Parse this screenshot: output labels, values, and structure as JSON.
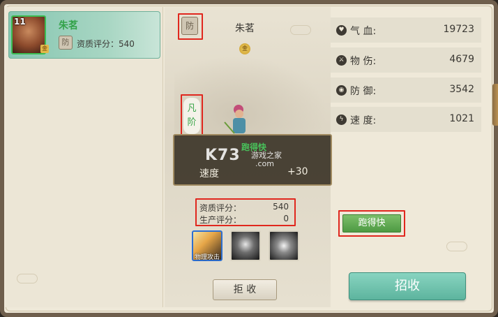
{
  "hero_card": {
    "level": "11",
    "name": "朱茗",
    "class_glyph": "防",
    "grade_glyph": "金",
    "score_text": "资质评分：540"
  },
  "unit": {
    "class_glyph": "防",
    "name": "朱茗",
    "grade_glyph": "金",
    "rank_text": "凡阶"
  },
  "tooltip": {
    "title": "跑得快",
    "stat_name": "速度",
    "stat_value": "+30"
  },
  "watermark": {
    "logo": "K73",
    "tagline": "游戏之家",
    "domain": ".com"
  },
  "scores": [
    {
      "label": "资质评分：",
      "value": "540"
    },
    {
      "label": "生产评分：",
      "value": "0"
    }
  ],
  "skills": {
    "skill_1_label": "物理攻击",
    "icons": [
      "physical-attack-skill-icon",
      "shadow-warrior-skill-icon",
      "spiral-skill-icon"
    ]
  },
  "stats": [
    {
      "icon": "heart-icon",
      "name": "气 血:",
      "value": "19723"
    },
    {
      "icon": "sword-icon",
      "name": "物 伤:",
      "value": "4679"
    },
    {
      "icon": "shield-icon",
      "name": "防 御:",
      "value": "3542"
    },
    {
      "icon": "lightning-icon",
      "name": "速 度:",
      "value": "1021"
    }
  ],
  "trait_badge": "跑得快",
  "buttons": {
    "reject": "拒 收",
    "recruit": "招收"
  },
  "colors": {
    "highlight_border": "#e0271e",
    "name_green": "#34a34b",
    "recruit_button": "#6cc2ab"
  }
}
